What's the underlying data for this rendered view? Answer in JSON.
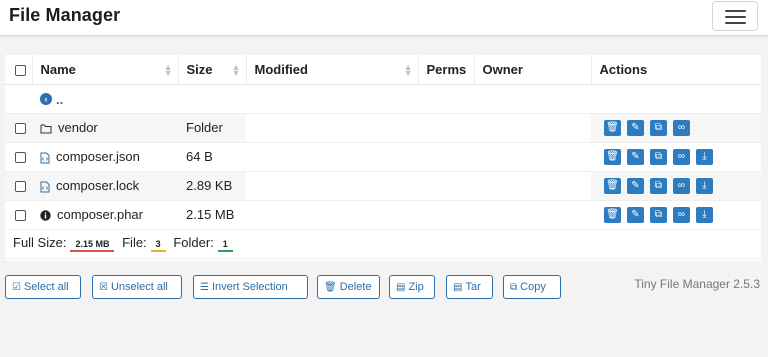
{
  "app": {
    "title": "File Manager",
    "version": "Tiny File Manager 2.5.3"
  },
  "table": {
    "headers": {
      "name": "Name",
      "size": "Size",
      "modified": "Modified",
      "perms": "Perms",
      "owner": "Owner",
      "actions": "Actions"
    },
    "parent_label": "..",
    "rows": [
      {
        "name": "vendor",
        "icon": "folder-icon",
        "size": "Folder",
        "modified": "",
        "perms": "",
        "owner": "",
        "has_download": false
      },
      {
        "name": "composer.json",
        "icon": "file-code-icon",
        "size": "64 B",
        "modified": "",
        "perms": "",
        "owner": "",
        "has_download": true
      },
      {
        "name": "composer.lock",
        "icon": "file-code-icon",
        "size": "2.89 KB",
        "modified": "",
        "perms": "",
        "owner": "",
        "has_download": true
      },
      {
        "name": "composer.phar",
        "icon": "info-circle-icon",
        "size": "2.15 MB",
        "modified": "",
        "perms": "",
        "owner": "",
        "has_download": true
      }
    ]
  },
  "summary": {
    "full_size_label": "Full Size:",
    "full_size": "2.15 MB",
    "file_label": "File:",
    "file_count": "3",
    "folder_label": "Folder:",
    "folder_count": "1"
  },
  "toolbar": {
    "select_all": "Select all",
    "unselect_all": "Unselect all",
    "invert_selection": "Invert Selection",
    "delete": "Delete",
    "zip": "Zip",
    "tar": "Tar",
    "copy": "Copy"
  },
  "colors": {
    "accent": "#2d7cc0",
    "full_size_underline": "#d9534f",
    "file_underline": "#e6b325",
    "folder_underline": "#2e9e56"
  }
}
